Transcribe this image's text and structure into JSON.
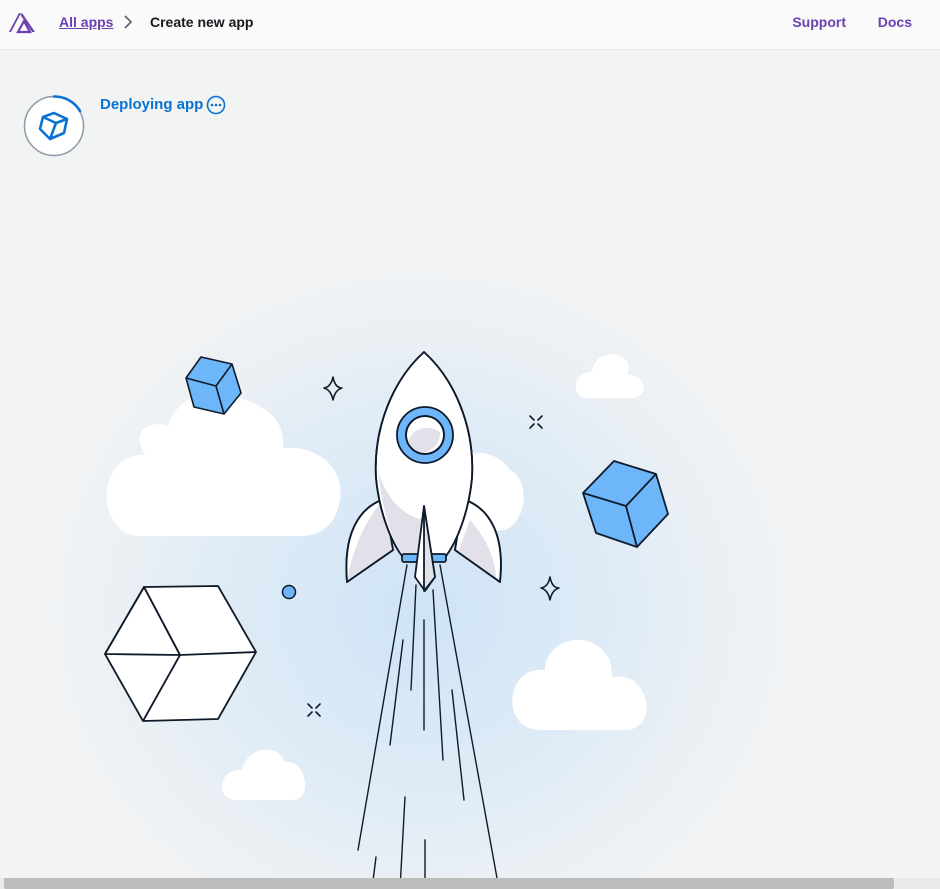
{
  "header": {
    "logo_icon": "amplify-logo-icon",
    "breadcrumb": {
      "all_apps_label": "All apps",
      "separator_icon": "chevron-right-icon",
      "current_label": "Create new app"
    },
    "nav": {
      "support_label": "Support",
      "docs_label": "Docs"
    }
  },
  "status": {
    "icon": "cube-icon",
    "label": "Deploying app",
    "more_icon": "ellipsis-circle-icon"
  },
  "illustration": {
    "subject": "rocket-launch",
    "colors": {
      "accent_blue": "#6cb6f9",
      "outline": "#0f1b2a",
      "cloud": "#ffffff",
      "rocket_shadow": "#e2e1ea"
    }
  },
  "colors": {
    "link_purple": "#6b40b1",
    "status_blue": "#0972d3",
    "text_dark": "#16191f"
  }
}
